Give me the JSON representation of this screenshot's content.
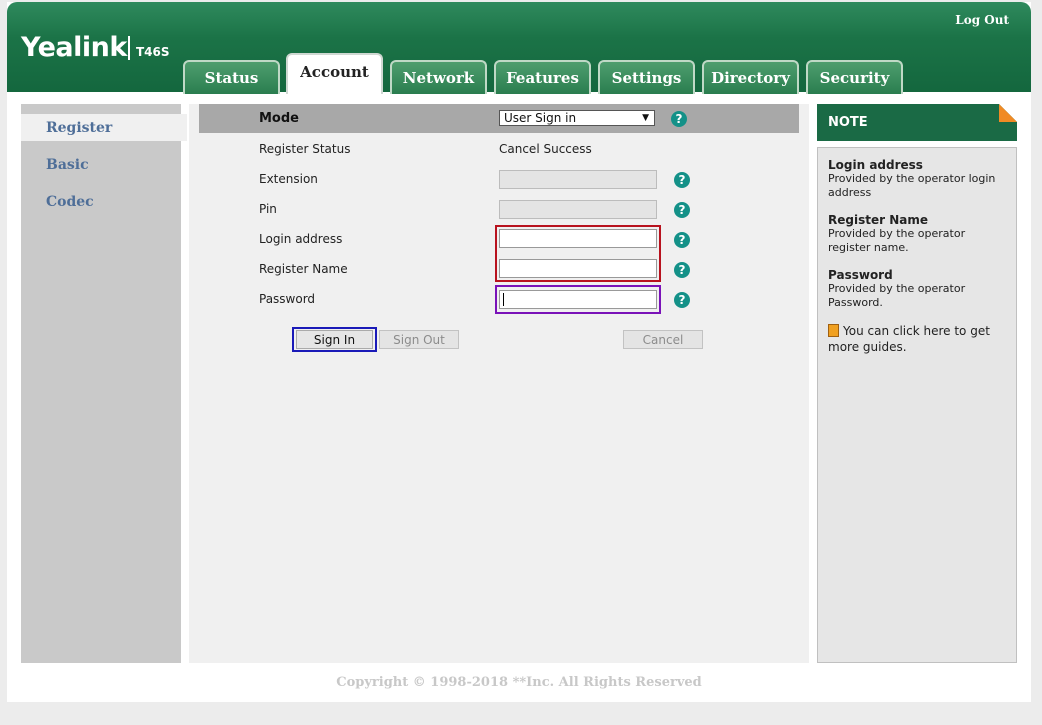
{
  "header": {
    "brand": "Yealink",
    "model": "T46S",
    "logout": "Log Out",
    "tabs": [
      {
        "label": "Status",
        "active": false
      },
      {
        "label": "Account",
        "active": true
      },
      {
        "label": "Network",
        "active": false
      },
      {
        "label": "Features",
        "active": false
      },
      {
        "label": "Settings",
        "active": false
      },
      {
        "label": "Directory",
        "active": false
      },
      {
        "label": "Security",
        "active": false
      }
    ]
  },
  "sidebar": {
    "items": [
      {
        "label": "Register",
        "active": true
      },
      {
        "label": "Basic",
        "active": false
      },
      {
        "label": "Codec",
        "active": false
      }
    ]
  },
  "form": {
    "mode_label": "Mode",
    "mode_value": "User Sign in",
    "register_status_label": "Register Status",
    "register_status_value": "Cancel Success",
    "extension_label": "Extension",
    "extension_value": "",
    "pin_label": "Pin",
    "pin_value": "",
    "login_address_label": "Login address",
    "login_address_value": "",
    "register_name_label": "Register Name",
    "register_name_value": "",
    "password_label": "Password",
    "password_value": "",
    "help_glyph": "?"
  },
  "buttons": {
    "sign_in": "Sign In",
    "sign_out": "Sign Out",
    "cancel": "Cancel"
  },
  "note": {
    "title": "NOTE",
    "entries": [
      {
        "title": "Login address",
        "desc": "Provided by the operator login address"
      },
      {
        "title": "Register Name",
        "desc": "Provided by the operator register name."
      },
      {
        "title": "Password",
        "desc": "Provided by the operator Password."
      }
    ],
    "guide": "You can click here to get more guides."
  },
  "footer": {
    "copyright": "Copyright © 1998-2018 **Inc. All Rights Reserved"
  },
  "colors": {
    "header_green": "#1b7347",
    "highlight_red": "#b8121e",
    "highlight_purple": "#7a12b8",
    "highlight_blue": "#1a1ab8",
    "help_teal": "#149188",
    "note_accent": "#f08a24"
  }
}
